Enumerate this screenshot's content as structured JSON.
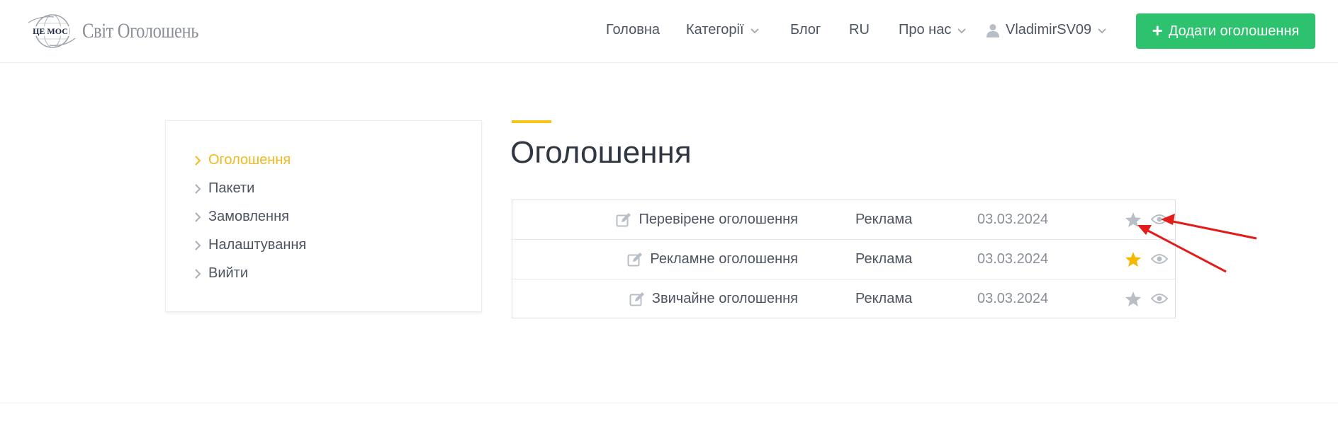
{
  "header": {
    "logo": {
      "globe_text": "ЦЕ МОС",
      "title": "Світ Оголошень"
    },
    "nav": {
      "home": "Головна",
      "categories": "Категорії",
      "blog": "Блог",
      "lang": "RU",
      "about": "Про нас",
      "user": "VladimirSV09"
    },
    "add_button": "Додати оголошення"
  },
  "sidebar": {
    "items": [
      {
        "label": "Оголошення",
        "active": true
      },
      {
        "label": "Пакети",
        "active": false
      },
      {
        "label": "Замовлення",
        "active": false
      },
      {
        "label": "Налаштування",
        "active": false
      },
      {
        "label": "Вийти",
        "active": false
      }
    ]
  },
  "main": {
    "title": "Оголошення",
    "rows": [
      {
        "title": "Перевірене оголошення",
        "category": "Реклама",
        "date": "03.03.2024",
        "featured": false
      },
      {
        "title": "Рекламне оголошення",
        "category": "Реклама",
        "date": "03.03.2024",
        "featured": true
      },
      {
        "title": "Звичайне оголошення",
        "category": "Реклама",
        "date": "03.03.2024",
        "featured": false
      }
    ]
  },
  "colors": {
    "accent_yellow": "#f5c518",
    "active_link": "#f2b91d",
    "button_green": "#2cc26e",
    "icon_gray": "#b8bec6",
    "star_active": "#f5b800",
    "annotation_red": "#e31b1b"
  },
  "icons": [
    "globe-logo-icon",
    "chevron-down-icon",
    "user-icon",
    "plus-icon",
    "chevron-right-icon",
    "edit-icon",
    "star-icon",
    "eye-icon"
  ]
}
